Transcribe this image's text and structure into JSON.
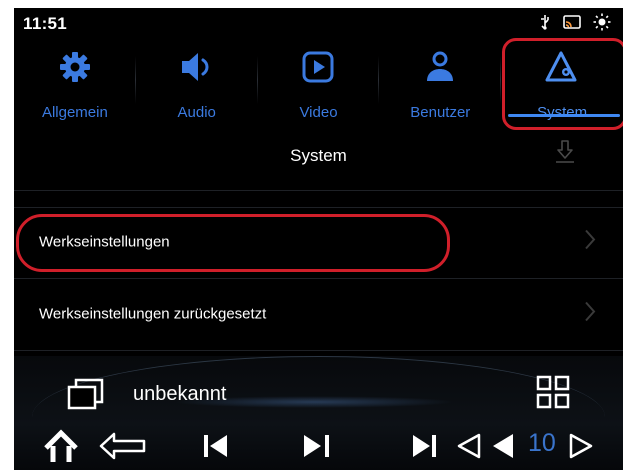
{
  "status_bar": {
    "time": "11:51",
    "icons": [
      "usb-icon",
      "cast-icon",
      "brightness-icon"
    ]
  },
  "tabs": [
    {
      "label": "Allgemein",
      "icon": "gear-icon"
    },
    {
      "label": "Audio",
      "icon": "speaker-icon"
    },
    {
      "label": "Video",
      "icon": "play-icon"
    },
    {
      "label": "Benutzer",
      "icon": "user-icon"
    },
    {
      "label": "System",
      "icon": "system-triangle-icon",
      "active": true
    }
  ],
  "header": {
    "title": "System",
    "download_icon": "download-icon"
  },
  "list": [
    {
      "label": "Werkseinstellungen"
    },
    {
      "label": "Werkseinstellungen zurückgesetzt"
    }
  ],
  "media": {
    "title": "unbekannt",
    "track_number": "10",
    "icons": [
      "window-icon",
      "grid-icon",
      "home-icon",
      "back-icon",
      "previous-icon",
      "play-pause-icon",
      "next-icon",
      "volume-down-icon",
      "volume-icon",
      "volume-up-icon"
    ]
  },
  "colors": {
    "accent": "#3b7ae0",
    "annotation": "#d01f2a",
    "background": "#000000"
  }
}
